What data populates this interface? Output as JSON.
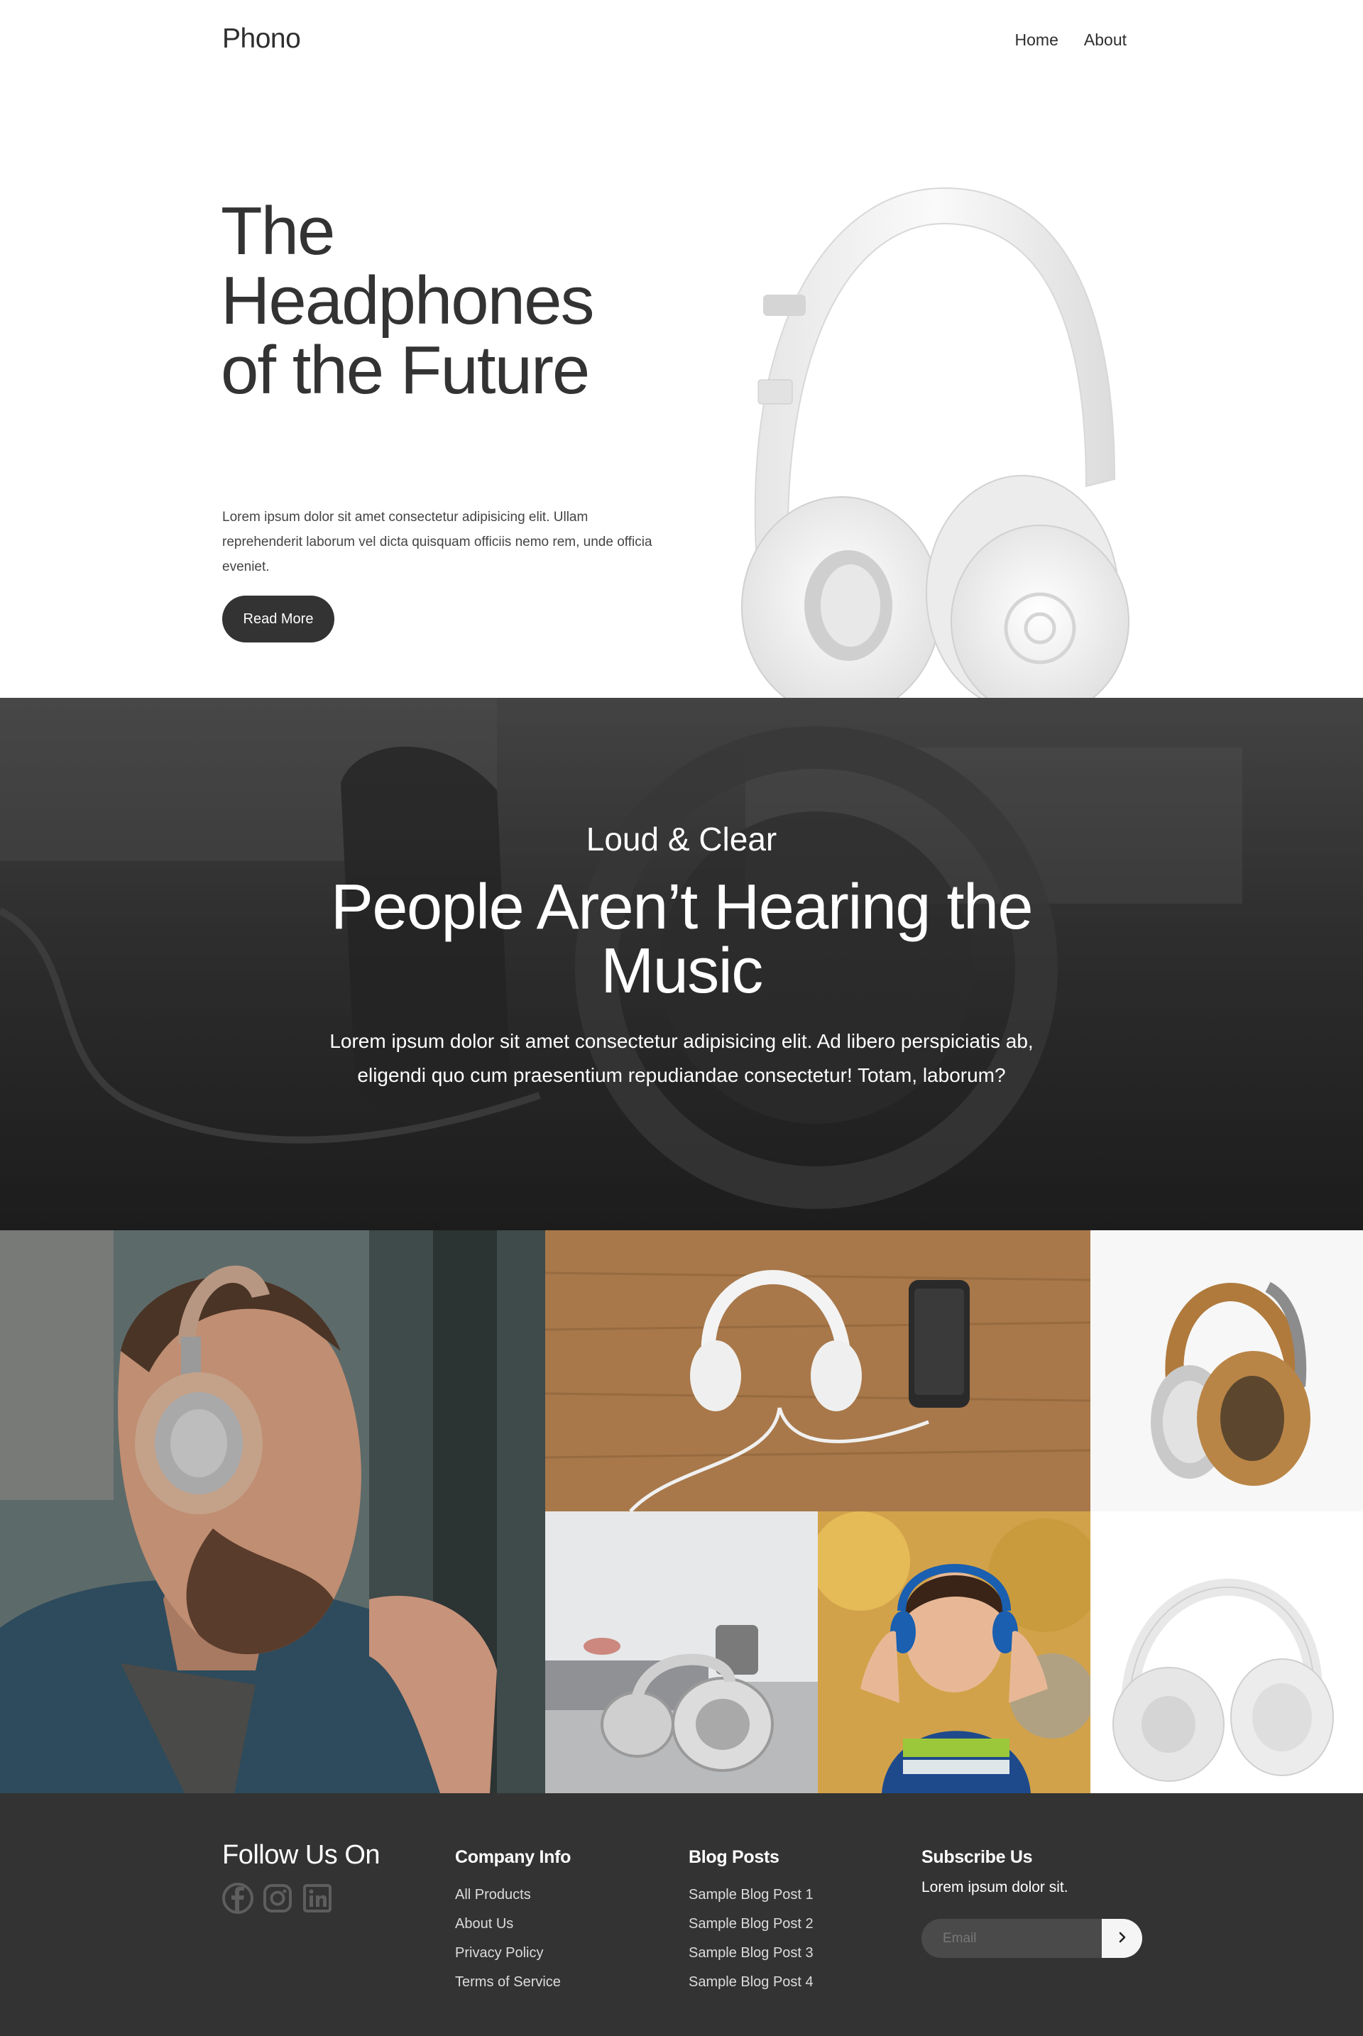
{
  "header": {
    "logo": "Phono",
    "nav": [
      {
        "label": "Home"
      },
      {
        "label": "About"
      }
    ]
  },
  "hero": {
    "title": "The Headphones of the Future",
    "description": "Lorem ipsum dolor sit amet consectetur adipisicing elit. Ullam reprehenderit laborum vel dicta quisquam officiis nemo rem, unde officia eveniet.",
    "button_label": "Read More"
  },
  "feature": {
    "subtitle": "Loud & Clear",
    "title": "People Aren’t Hearing the Music",
    "description": "Lorem ipsum dolor sit amet consectetur adipisicing elit. Ad libero perspiciatis ab, eligendi quo cum praesentium repudiandae consectetur! Totam, laborum?"
  },
  "gallery": {
    "tiles": [
      {
        "subject": "man with tan headphones"
      },
      {
        "subject": "white headphones and phone on wooden table"
      },
      {
        "subject": "tan headphones product"
      },
      {
        "subject": "headphones beside laptop"
      },
      {
        "subject": "child with blue headphones"
      },
      {
        "subject": "white headphones product"
      }
    ]
  },
  "footer": {
    "follow_title": "Follow Us On",
    "social_icons": [
      "facebook-icon",
      "instagram-icon",
      "linkedin-icon"
    ],
    "company": {
      "title": "Company Info",
      "links": [
        "All Products",
        "About Us",
        "Privacy Policy",
        "Terms of Service"
      ]
    },
    "blog": {
      "title": "Blog Posts",
      "links": [
        "Sample Blog Post 1",
        "Sample Blog Post 2",
        "Sample Blog Post 3",
        "Sample Blog Post 4"
      ]
    },
    "subscribe": {
      "title": "Subscribe Us",
      "text": "Lorem ipsum dolor sit.",
      "email_placeholder": "Email"
    }
  },
  "colors": {
    "dark": "#333333",
    "footer_bg": "#333333",
    "white": "#ffffff"
  }
}
